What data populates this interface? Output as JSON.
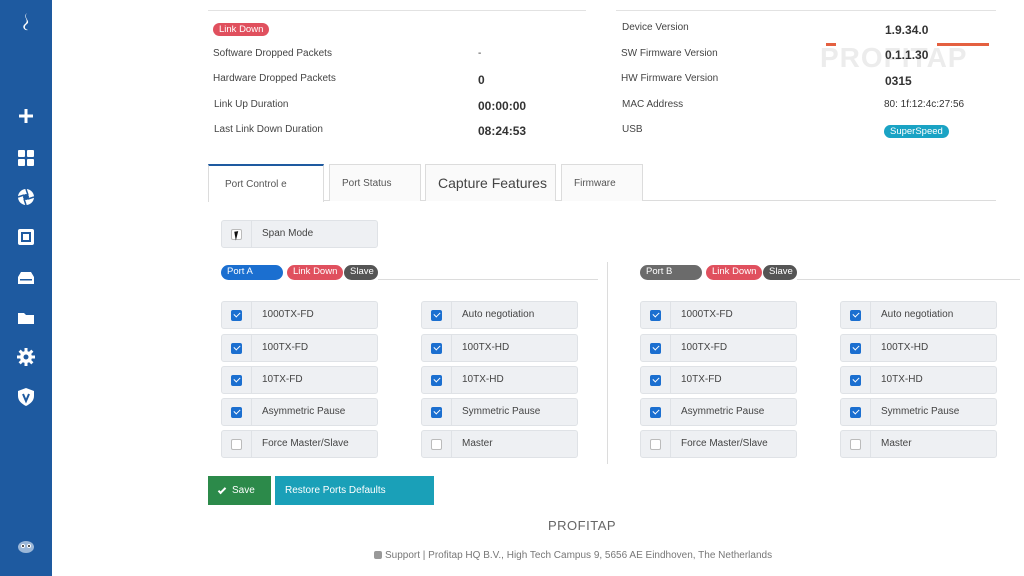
{
  "sidebar": {
    "icons": [
      "logo-icon",
      "add-icon",
      "dashboard-icon",
      "aperture-icon",
      "device-icon",
      "storage-icon",
      "folder-icon",
      "gear-icon",
      "shield-icon",
      "mascot-icon"
    ]
  },
  "status": {
    "link_badge": "Link Down",
    "rows": [
      {
        "label": "Software Dropped Packets",
        "value": "-"
      },
      {
        "label": "Hardware Dropped Packets",
        "value": "0"
      },
      {
        "label": "Link Up Duration",
        "value": "00:00:00"
      },
      {
        "label": "Last Link Down Duration",
        "value": "08:24:53"
      }
    ]
  },
  "device": {
    "rows": [
      {
        "label": "Device Version",
        "value": "1.9.34.0"
      },
      {
        "label": "SW Firmware Version",
        "value": "0.1.1.30"
      },
      {
        "label": "HW Firmware Version",
        "value": "0315"
      },
      {
        "label": "MAC Address",
        "value": "80:  1f:12:4c:27:56"
      },
      {
        "label": "USB",
        "value": "SuperSpeed"
      }
    ],
    "watermark": "PROFITAP"
  },
  "tabs": [
    "Port Control e",
    "Port Status",
    "Capture Features",
    "Firmware"
  ],
  "span_mode": {
    "label": "Span Mode",
    "checked": false
  },
  "portA": {
    "name": "Port A",
    "link": "Link Down",
    "role": "Slave",
    "left": [
      {
        "label": "1000TX-FD",
        "checked": true
      },
      {
        "label": "100TX-FD",
        "checked": true
      },
      {
        "label": "10TX-FD",
        "checked": true
      },
      {
        "label": "Asymmetric Pause",
        "checked": true
      },
      {
        "label": "Force Master/Slave",
        "checked": false
      }
    ],
    "right": [
      {
        "label": "Auto negotiation",
        "checked": true
      },
      {
        "label": "100TX-HD",
        "checked": true
      },
      {
        "label": "10TX-HD",
        "checked": true
      },
      {
        "label": "Symmetric Pause",
        "checked": true
      },
      {
        "label": "Master",
        "checked": false
      }
    ]
  },
  "portB": {
    "name": "Port B",
    "link": "Link Down",
    "role": "Slave",
    "left": [
      {
        "label": "1000TX-FD",
        "checked": true
      },
      {
        "label": "100TX-FD",
        "checked": true
      },
      {
        "label": "10TX-FD",
        "checked": true
      },
      {
        "label": "Asymmetric Pause",
        "checked": true
      },
      {
        "label": "Force Master/Slave",
        "checked": false
      }
    ],
    "right": [
      {
        "label": "Auto negotiation",
        "checked": true
      },
      {
        "label": "100TX-HD",
        "checked": true
      },
      {
        "label": "10TX-HD",
        "checked": true
      },
      {
        "label": "Symmetric Pause",
        "checked": true
      },
      {
        "label": "Master",
        "checked": false
      }
    ]
  },
  "buttons": {
    "save": "Save",
    "restore": "Restore Ports Defaults"
  },
  "footer": {
    "brand": "PROFITAP",
    "text": "Support | Profitap HQ B.V., High Tech Campus 9, 5656 AE Eindhoven, The Netherlands"
  }
}
